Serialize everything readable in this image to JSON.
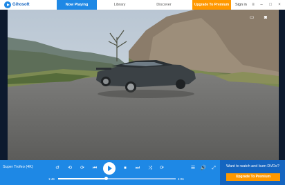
{
  "app": {
    "logo_text": "Gihosoft",
    "colors": {
      "accent": "#1e88e5",
      "upgrade": "#ff9800"
    }
  },
  "tabs": [
    {
      "label": "Now Playing",
      "active": true
    },
    {
      "label": "Library",
      "active": false
    },
    {
      "label": "Discover",
      "active": false
    }
  ],
  "header": {
    "upgrade_label": "Upgrade To Premium",
    "signin_label": "Sign in"
  },
  "window_controls": [
    "≡",
    "–",
    "□",
    "×"
  ],
  "video_icons": [
    "screen-mirror-icon",
    "camera-icon"
  ],
  "player": {
    "title": "Super Trofeo (4K)",
    "elapsed": "1:49",
    "duration": "4:26",
    "progress_fraction": 0.41
  },
  "promo": {
    "text": "Want to watch and burn DVDs?",
    "button_label": "Upgrade To Premium"
  }
}
